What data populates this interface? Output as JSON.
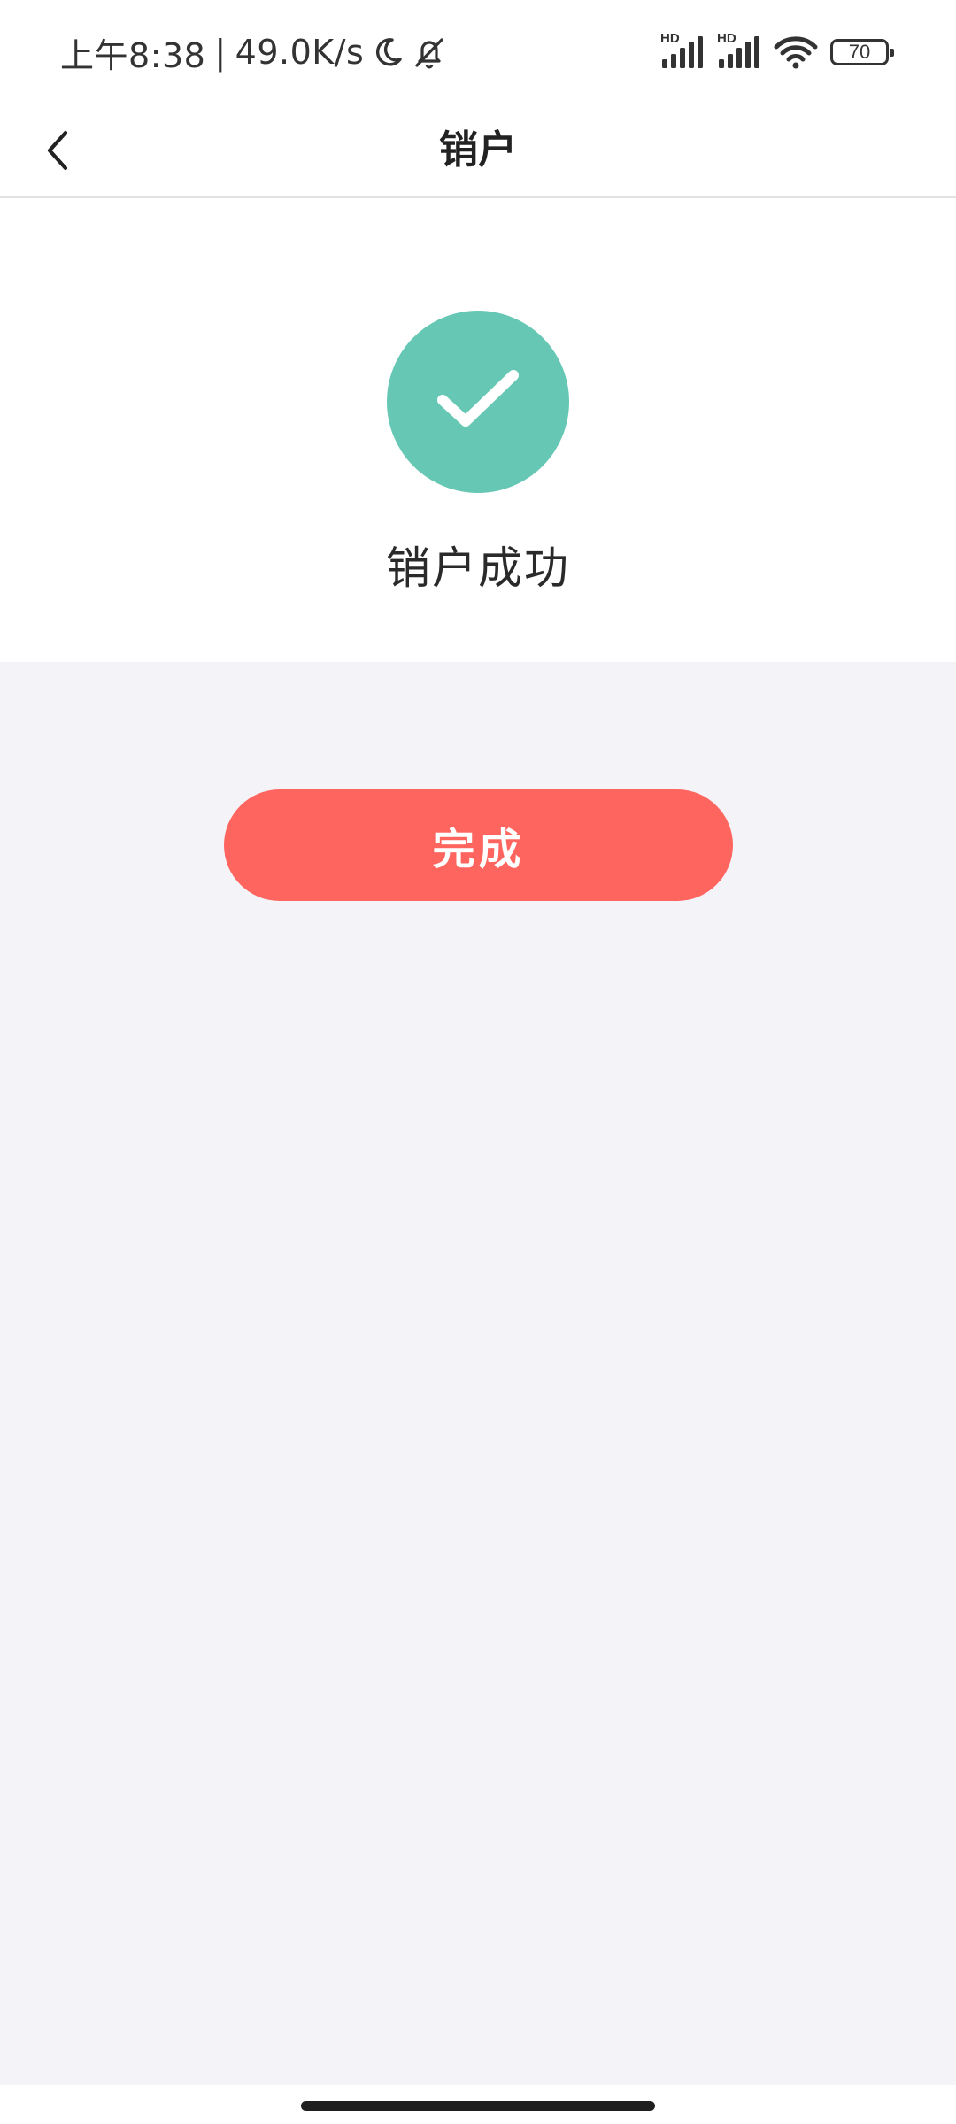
{
  "status_bar": {
    "time": "上午8:38",
    "separator": "|",
    "network_speed": "49.0K/s",
    "left_icons": [
      "moon-icon",
      "bell-off-icon"
    ],
    "signal_1_label": "HD",
    "signal_2_label": "HD",
    "right_icons": [
      "signal-icon",
      "signal-icon",
      "wifi-icon",
      "battery-icon"
    ],
    "battery_level": "70"
  },
  "nav": {
    "title": "销户",
    "back_icon": "chevron-left-icon"
  },
  "result": {
    "icon": "check-icon",
    "message": "销户成功"
  },
  "actions": {
    "done_label": "完成"
  },
  "colors": {
    "success": "#66c8b4",
    "primary_button": "#ff655f",
    "page_background": "#f3f3f8",
    "panel_background": "#ffffff"
  }
}
